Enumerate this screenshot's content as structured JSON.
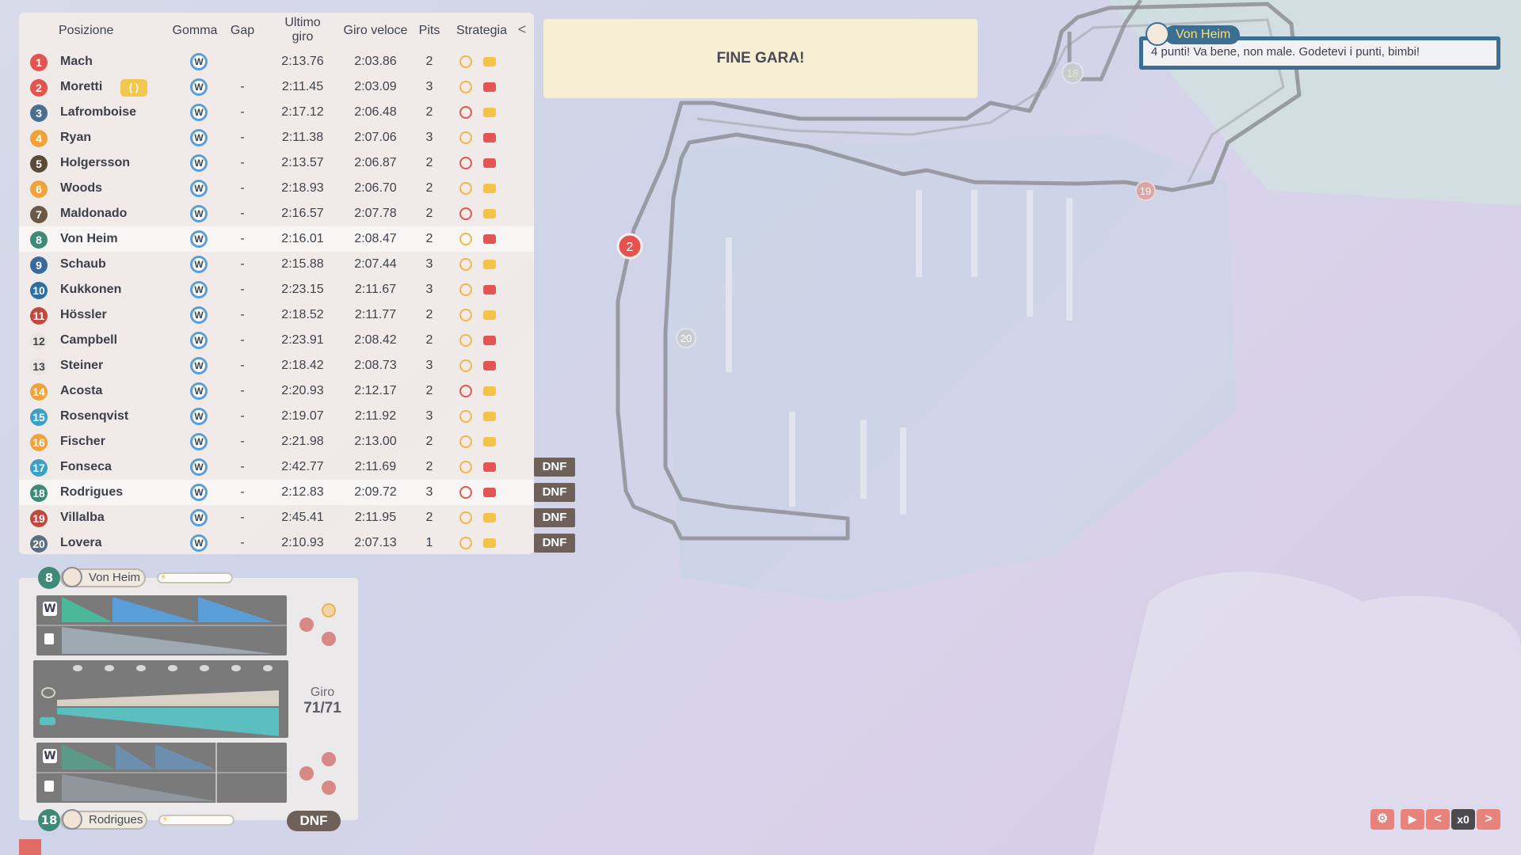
{
  "headers": {
    "position": "Posizione",
    "tyre": "Gomma",
    "gap": "Gap",
    "last_lap_line1": "Ultimo",
    "last_lap_line2": "giro",
    "fastest_lap": "Giro veloce",
    "pits": "Pits",
    "strategy": "Strategia",
    "collapse": "<"
  },
  "banner": "FINE GARA!",
  "radio": {
    "driver": "Von Heim",
    "message": "4 punti! Va bene, non male. Godetevi i punti, bimbi!"
  },
  "standings": [
    {
      "pos": "1",
      "color": "#e4534f",
      "name": "Mach",
      "tyre": "W",
      "gap": "",
      "last": "2:13.76",
      "fast": "2:03.86",
      "pits": "2",
      "s1": "yellow",
      "s2": "yellow"
    },
    {
      "pos": "2",
      "color": "#e4534f",
      "name": "Moretti",
      "badge": "( )",
      "tyre": "W",
      "gap": "-",
      "last": "2:11.45",
      "fast": "2:03.09",
      "pits": "3",
      "s1": "yellow",
      "s2": "red"
    },
    {
      "pos": "3",
      "color": "#4a6f8f",
      "name": "Lafromboise",
      "tyre": "W",
      "gap": "-",
      "last": "2:17.12",
      "fast": "2:06.48",
      "pits": "2",
      "s1": "red",
      "s2": "yellow"
    },
    {
      "pos": "4",
      "color": "#f0a33a",
      "name": "Ryan",
      "tyre": "W",
      "gap": "-",
      "last": "2:11.38",
      "fast": "2:07.06",
      "pits": "3",
      "s1": "yellow",
      "s2": "red"
    },
    {
      "pos": "5",
      "color": "#5a4a3a",
      "name": "Holgersson",
      "tyre": "W",
      "gap": "-",
      "last": "2:13.57",
      "fast": "2:06.87",
      "pits": "2",
      "s1": "red",
      "s2": "red"
    },
    {
      "pos": "6",
      "color": "#f0a33a",
      "name": "Woods",
      "tyre": "W",
      "gap": "-",
      "last": "2:18.93",
      "fast": "2:06.70",
      "pits": "2",
      "s1": "yellow",
      "s2": "yellow"
    },
    {
      "pos": "7",
      "color": "#6a5a45",
      "name": "Maldonado",
      "tyre": "W",
      "gap": "-",
      "last": "2:16.57",
      "fast": "2:07.78",
      "pits": "2",
      "s1": "red",
      "s2": "yellow"
    },
    {
      "pos": "8",
      "color": "#3f8a76",
      "name": "Von Heim",
      "tyre": "W",
      "gap": "-",
      "last": "2:16.01",
      "fast": "2:08.47",
      "pits": "2",
      "s1": "yellow",
      "s2": "red",
      "selected": true
    },
    {
      "pos": "9",
      "color": "#3a6a9a",
      "name": "Schaub",
      "tyre": "W",
      "gap": "-",
      "last": "2:15.88",
      "fast": "2:07.44",
      "pits": "3",
      "s1": "yellow",
      "s2": "yellow"
    },
    {
      "pos": "10",
      "color": "#2d6fa0",
      "name": "Kukkonen",
      "tyre": "W",
      "gap": "-",
      "last": "2:23.15",
      "fast": "2:11.67",
      "pits": "3",
      "s1": "yellow",
      "s2": "red"
    },
    {
      "pos": "11",
      "color": "#c0483f",
      "name": "Hössler",
      "tyre": "W",
      "gap": "-",
      "last": "2:18.52",
      "fast": "2:11.77",
      "pits": "2",
      "s1": "yellow",
      "s2": "yellow"
    },
    {
      "pos": "12",
      "color": "#e9e6e2",
      "name": "Campbell",
      "tyre": "W",
      "gap": "-",
      "last": "2:23.91",
      "fast": "2:08.42",
      "pits": "2",
      "s1": "yellow",
      "s2": "red"
    },
    {
      "pos": "13",
      "color": "#e9e6e2",
      "name": "Steiner",
      "tyre": "W",
      "gap": "-",
      "last": "2:18.42",
      "fast": "2:08.73",
      "pits": "3",
      "s1": "yellow",
      "s2": "red"
    },
    {
      "pos": "14",
      "color": "#f0a33a",
      "name": "Acosta",
      "tyre": "W",
      "gap": "-",
      "last": "2:20.93",
      "fast": "2:12.17",
      "pits": "2",
      "s1": "red",
      "s2": "yellow"
    },
    {
      "pos": "15",
      "color": "#3aa0c8",
      "name": "Rosenqvist",
      "tyre": "W",
      "gap": "-",
      "last": "2:19.07",
      "fast": "2:11.92",
      "pits": "3",
      "s1": "yellow",
      "s2": "yellow"
    },
    {
      "pos": "16",
      "color": "#f0a33a",
      "name": "Fischer",
      "tyre": "W",
      "gap": "-",
      "last": "2:21.98",
      "fast": "2:13.00",
      "pits": "2",
      "s1": "yellow",
      "s2": "yellow"
    },
    {
      "pos": "17",
      "color": "#3aa0c8",
      "name": "Fonseca",
      "tyre": "W",
      "gap": "-",
      "last": "2:42.77",
      "fast": "2:11.69",
      "pits": "2",
      "s1": "yellow",
      "s2": "red",
      "dnf": "DNF"
    },
    {
      "pos": "18",
      "color": "#3f8a76",
      "name": "Rodrigues",
      "tyre": "W",
      "gap": "-",
      "last": "2:12.83",
      "fast": "2:09.72",
      "pits": "3",
      "s1": "red",
      "s2": "red",
      "dnf": "DNF",
      "selected": true
    },
    {
      "pos": "19",
      "color": "#c0483f",
      "name": "Villalba",
      "tyre": "W",
      "gap": "-",
      "last": "2:45.41",
      "fast": "2:11.95",
      "pits": "2",
      "s1": "yellow",
      "s2": "yellow",
      "dnf": "DNF"
    },
    {
      "pos": "20",
      "color": "#5c6f80",
      "name": "Lovera",
      "tyre": "W",
      "gap": "-",
      "last": "2:10.93",
      "fast": "2:07.13",
      "pits": "1",
      "s1": "yellow",
      "s2": "yellow",
      "dnf": "DNF"
    }
  ],
  "detail": {
    "driver1": {
      "pos": "8",
      "name": "Von Heim",
      "color": "#3f8a76"
    },
    "driver2": {
      "pos": "18",
      "name": "Rodrigues",
      "color": "#3f8a76",
      "status": "DNF"
    },
    "tyre_letter": "W",
    "lap_label": "Giro",
    "lap_value": "71/71"
  },
  "map_markers": [
    {
      "label": "2",
      "color": "#e4534f"
    },
    {
      "label": "18",
      "color": "#c9cbd2"
    },
    {
      "label": "19",
      "color": "#d7a7a7"
    },
    {
      "label": "20",
      "color": "#c9cbd2"
    }
  ],
  "controls": {
    "settings_icon": "gear-icon",
    "play": "▶",
    "prev": "<",
    "speed": "x0",
    "next": ">"
  }
}
